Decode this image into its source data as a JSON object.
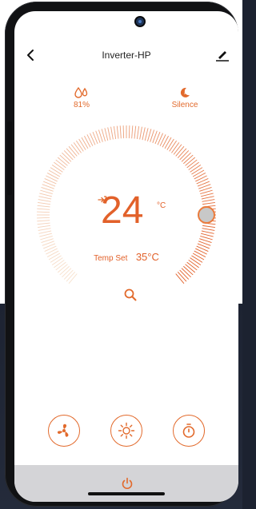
{
  "header": {
    "title": "Inverter-HP"
  },
  "stats": {
    "humidity": {
      "value": "81%",
      "icon": "humidity-icon"
    },
    "mode": {
      "value": "Silence",
      "icon": "moon-icon"
    }
  },
  "thermostat": {
    "current_temp": "24",
    "current_unit": "°C",
    "set_label": "Temp Set",
    "set_value": "35°C"
  },
  "controls": {
    "fan": "fan-icon",
    "sun": "sun-icon",
    "timer": "timer-icon"
  },
  "colors": {
    "accent": "#e2612a",
    "tick_light": "#f7d6c0",
    "knob": "#c8c8c8",
    "bottom_bar": "#d4d4d7"
  }
}
